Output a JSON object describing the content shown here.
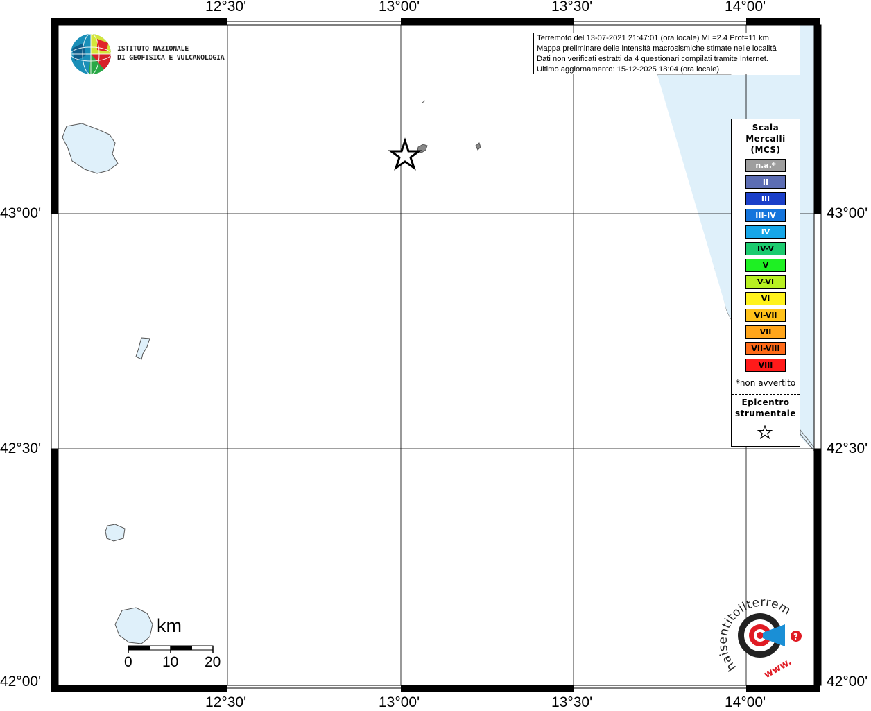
{
  "axes": {
    "top": [
      "12°30'",
      "13°00'",
      "13°30'",
      "14°00'"
    ],
    "bottom": [
      "12°30'",
      "13°00'",
      "13°30'",
      "14°00'"
    ],
    "left": [
      "43°00'",
      "42°30'",
      "42°00'"
    ],
    "right": [
      "43°00'",
      "42°30'",
      "42°00'"
    ]
  },
  "info": {
    "line1": "Terremoto del 13-07-2021 21:47:01 (ora locale) ML=2.4 Prof=11 km",
    "line2": "Mappa preliminare delle intensità macrosismiche stimate nelle località",
    "line3": "Dati non verificati estratti da 4 questionari compilati tramite Internet.",
    "line4": "Ultimo aggiornamento: 15-12-2025 18:04 (ora locale)"
  },
  "logo": {
    "line1": "ISTITUTO NAZIONALE",
    "line2": "DI GEOFISICA E VULCANOLOGIA"
  },
  "legend": {
    "title1": "Scala",
    "title2": "Mercalli",
    "title3": "(MCS)",
    "items": [
      {
        "label": "n.a.*",
        "color": "#9e9e9e",
        "text": "#ffffff"
      },
      {
        "label": "II",
        "color": "#5c6db3",
        "text": "#ffffff"
      },
      {
        "label": "III",
        "color": "#1a3fc9",
        "text": "#ffffff"
      },
      {
        "label": "III-IV",
        "color": "#1474dc",
        "text": "#ffffff"
      },
      {
        "label": "IV",
        "color": "#16a6e8",
        "text": "#ffffff"
      },
      {
        "label": "IV-V",
        "color": "#1ccb6f",
        "text": "#000000"
      },
      {
        "label": "V",
        "color": "#1ef023",
        "text": "#000000"
      },
      {
        "label": "V-VI",
        "color": "#b8f021",
        "text": "#000000"
      },
      {
        "label": "VI",
        "color": "#fff21c",
        "text": "#000000"
      },
      {
        "label": "VI-VII",
        "color": "#ffc21a",
        "text": "#000000"
      },
      {
        "label": "VII",
        "color": "#ffa51a",
        "text": "#000000"
      },
      {
        "label": "VII-VIII",
        "color": "#ff6a18",
        "text": "#000000"
      },
      {
        "label": "VIII",
        "color": "#ff1a1a",
        "text": "#000000"
      }
    ],
    "note": "*non avvertito",
    "epi1": "Epicentro",
    "epi2": "strumentale"
  },
  "scale": {
    "unit": "km",
    "ticks": [
      "0",
      "10",
      "20"
    ]
  },
  "brand": {
    "text": "haisentitoilterremoto.it",
    "www": "www."
  },
  "colors": {
    "water": "#dff0fa",
    "coast": "#555555",
    "frame": "#000000",
    "brandRed": "#e01b24"
  }
}
